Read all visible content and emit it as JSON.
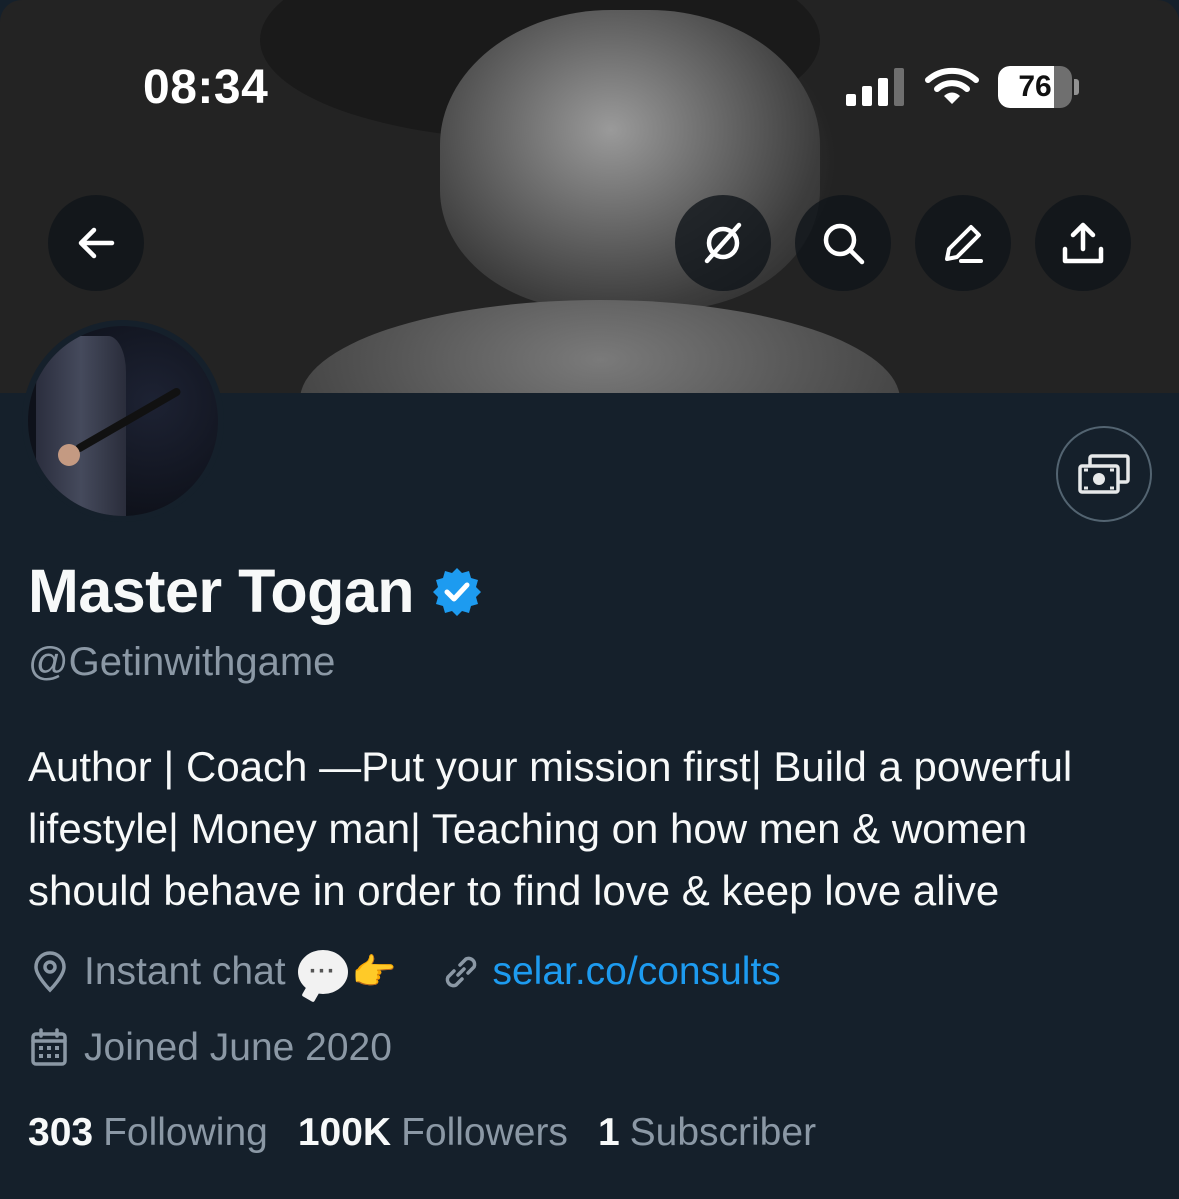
{
  "status_bar": {
    "time": "08:34",
    "battery_level": "76",
    "battery_fraction": 0.76,
    "signal_bars_active": 3
  },
  "header_actions": {
    "back_icon": "arrow-left-icon",
    "grok_icon": "grok-slash-circle-icon",
    "search_icon": "search-icon",
    "edit_icon": "pencil-icon",
    "share_icon": "share-upload-icon"
  },
  "profile": {
    "display_name": "Master Togan",
    "verified": true,
    "handle": "@Getinwithgame",
    "bio": "Author | Coach —Put your mission first| Build a powerful lifestyle| Money man| Teaching on how men & women should behave in order to find love & keep love alive",
    "location": "Instant chat",
    "location_emoji": [
      "speech-bubble",
      "pointing-right-hand"
    ],
    "link": "selar.co/consults",
    "joined": "Joined June 2020",
    "subscribe_icon": "money-icon"
  },
  "stats": [
    {
      "value": "303",
      "label": "Following"
    },
    {
      "value": "100K",
      "label": "Followers"
    },
    {
      "value": "1",
      "label": "Subscriber"
    }
  ],
  "colors": {
    "background": "#15202b",
    "secondary_text": "#8b98a5",
    "link": "#1d9bf0",
    "verified_badge": "#1d9bf0"
  }
}
